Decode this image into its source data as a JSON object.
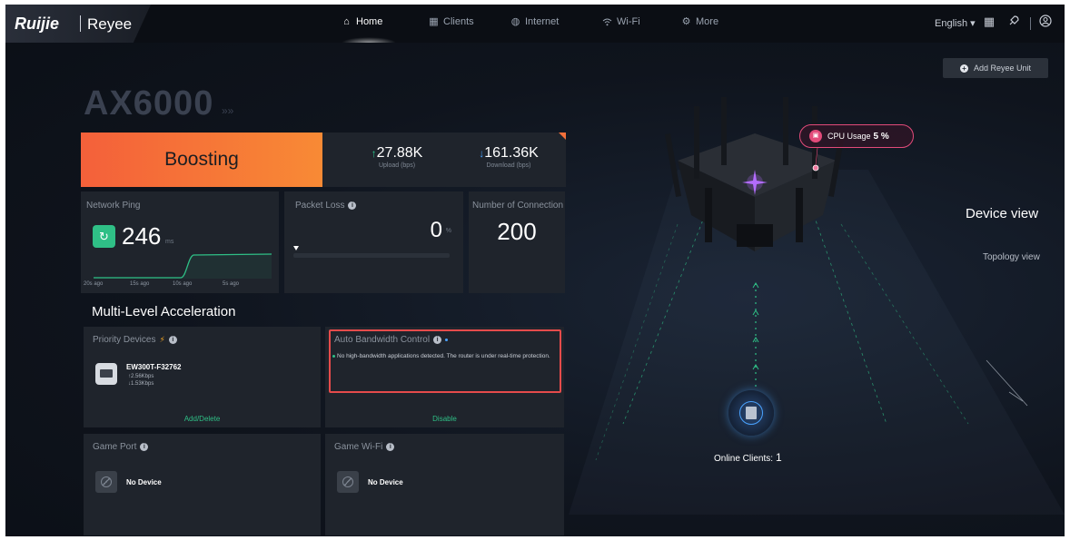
{
  "brand": {
    "logo": "Ruijie",
    "product": "Reyee"
  },
  "nav": {
    "home": "Home",
    "clients": "Clients",
    "internet": "Internet",
    "wifi": "Wi-Fi",
    "more": "More"
  },
  "top_right": {
    "language": "English ▾",
    "icons": [
      "qr-code-icon",
      "rocket-icon",
      "user-icon"
    ]
  },
  "model": {
    "name": "AX6000",
    "suffix": "»»"
  },
  "boost": {
    "label": "Boosting"
  },
  "speed": {
    "upload": {
      "value": "27.88K",
      "label": "Upload (bps)"
    },
    "download": {
      "value": "161.36K",
      "label": "Download (bps)"
    }
  },
  "ping": {
    "title": "Network Ping",
    "value": "246",
    "unit": "ms",
    "axis": [
      "20s ago",
      "15s ago",
      "10s ago",
      "5s ago"
    ]
  },
  "packet_loss": {
    "title": "Packet Loss",
    "value": "0",
    "unit": "%"
  },
  "connections": {
    "title": "Number of Connection",
    "value": "200"
  },
  "section": {
    "title": "Multi-Level Acceleration"
  },
  "priority": {
    "title": "Priority Devices",
    "device_name": "EW300T-F32762",
    "up": "↑2.56Kbps",
    "down": "↓1.53Kbps",
    "action": "Add/Delete"
  },
  "auto_bandwidth": {
    "title": "Auto Bandwidth Control",
    "message": "No high-bandwidth applications detected. The router is under real-time protection.",
    "action": "Disable"
  },
  "game_port": {
    "title": "Game Port",
    "empty": "No Device"
  },
  "game_wifi": {
    "title": "Game Wi-Fi",
    "empty": "No Device"
  },
  "right": {
    "add_unit": "Add Reyee Unit",
    "cpu_label": "CPU Usage",
    "cpu_value": "5 %",
    "device_view": "Device view",
    "topology_view": "Topology view",
    "online_label": "Online Clients:",
    "online_count": "1"
  },
  "colors": {
    "accent_orange": "#f4603a",
    "accent_green": "#2fbf86",
    "alert_red": "#e54b4b",
    "cpu_pink": "#e34b7a"
  }
}
